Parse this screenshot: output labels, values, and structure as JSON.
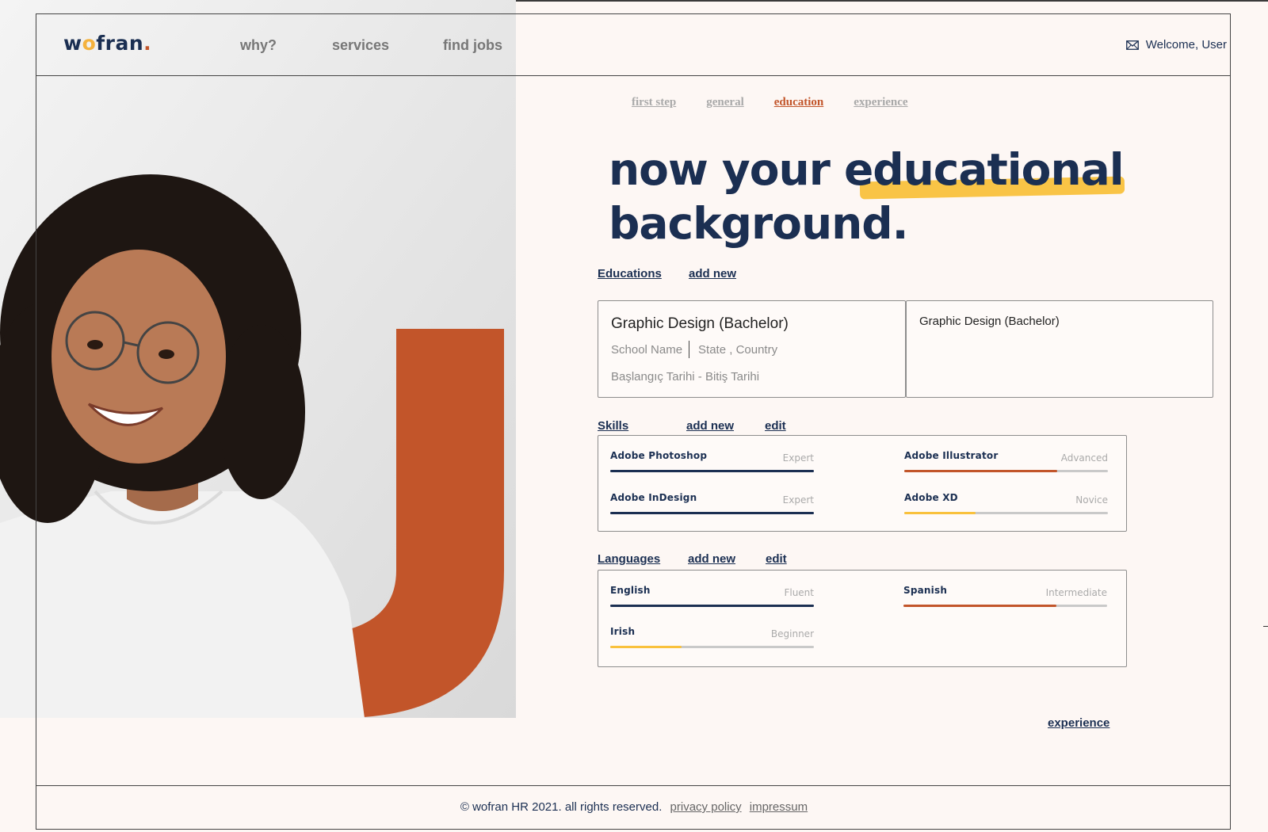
{
  "brand": {
    "logo_w": "w",
    "logo_o": "o",
    "logo_rest": "fran",
    "logo_dot": "."
  },
  "nav": {
    "why": "why?",
    "services": "services",
    "find_jobs": "find jobs"
  },
  "user": {
    "welcome": "Welcome, User"
  },
  "steps": [
    {
      "label": "first step",
      "active": false
    },
    {
      "label": "general",
      "active": false
    },
    {
      "label": "education",
      "active": true
    },
    {
      "label": "experience",
      "active": false
    }
  ],
  "headline": {
    "line1": "now your educational",
    "line2": "background."
  },
  "educations": {
    "title": "Educations",
    "add_new": "add new",
    "cards": [
      {
        "degree": "Graphic Design (Bachelor)",
        "school": "School Name",
        "location": "State , Country",
        "dates": "Başlangıç Tarihi - Bitiş Tarihi"
      },
      {
        "degree": "Graphic Design (Bachelor)"
      }
    ]
  },
  "skills": {
    "title": "Skills",
    "add_new": "add new",
    "edit": "edit",
    "items": [
      {
        "name": "Adobe Photoshop",
        "level": "Expert",
        "fraction": 1.0,
        "color": "#1b2f52"
      },
      {
        "name": "Adobe Illustrator",
        "level": "Advanced",
        "fraction": 0.75,
        "color": "#c2552a"
      },
      {
        "name": "Adobe InDesign",
        "level": "Expert",
        "fraction": 1.0,
        "color": "#1b2f52"
      },
      {
        "name": "Adobe XD",
        "level": "Novice",
        "fraction": 0.35,
        "color": "#f9c13c"
      }
    ]
  },
  "languages": {
    "title": "Languages",
    "add_new": "add new",
    "edit": "edit",
    "items": [
      {
        "name": "English",
        "level": "Fluent",
        "fraction": 1.0,
        "color": "#1b2f52"
      },
      {
        "name": "Spanish",
        "level": "Intermediate",
        "fraction": 0.75,
        "color": "#c2552a"
      },
      {
        "name": "Irish",
        "level": "Beginner",
        "fraction": 0.35,
        "color": "#f9c13c"
      }
    ]
  },
  "next": "experience",
  "footer": {
    "copyright": "© wofran HR 2021. all rights reserved.",
    "privacy": "privacy policy",
    "impressum": "impressum"
  },
  "colors": {
    "navy": "#1b2f52",
    "orange": "#c2552a",
    "yellow": "#f9c13c",
    "background": "#fdf7f4"
  }
}
